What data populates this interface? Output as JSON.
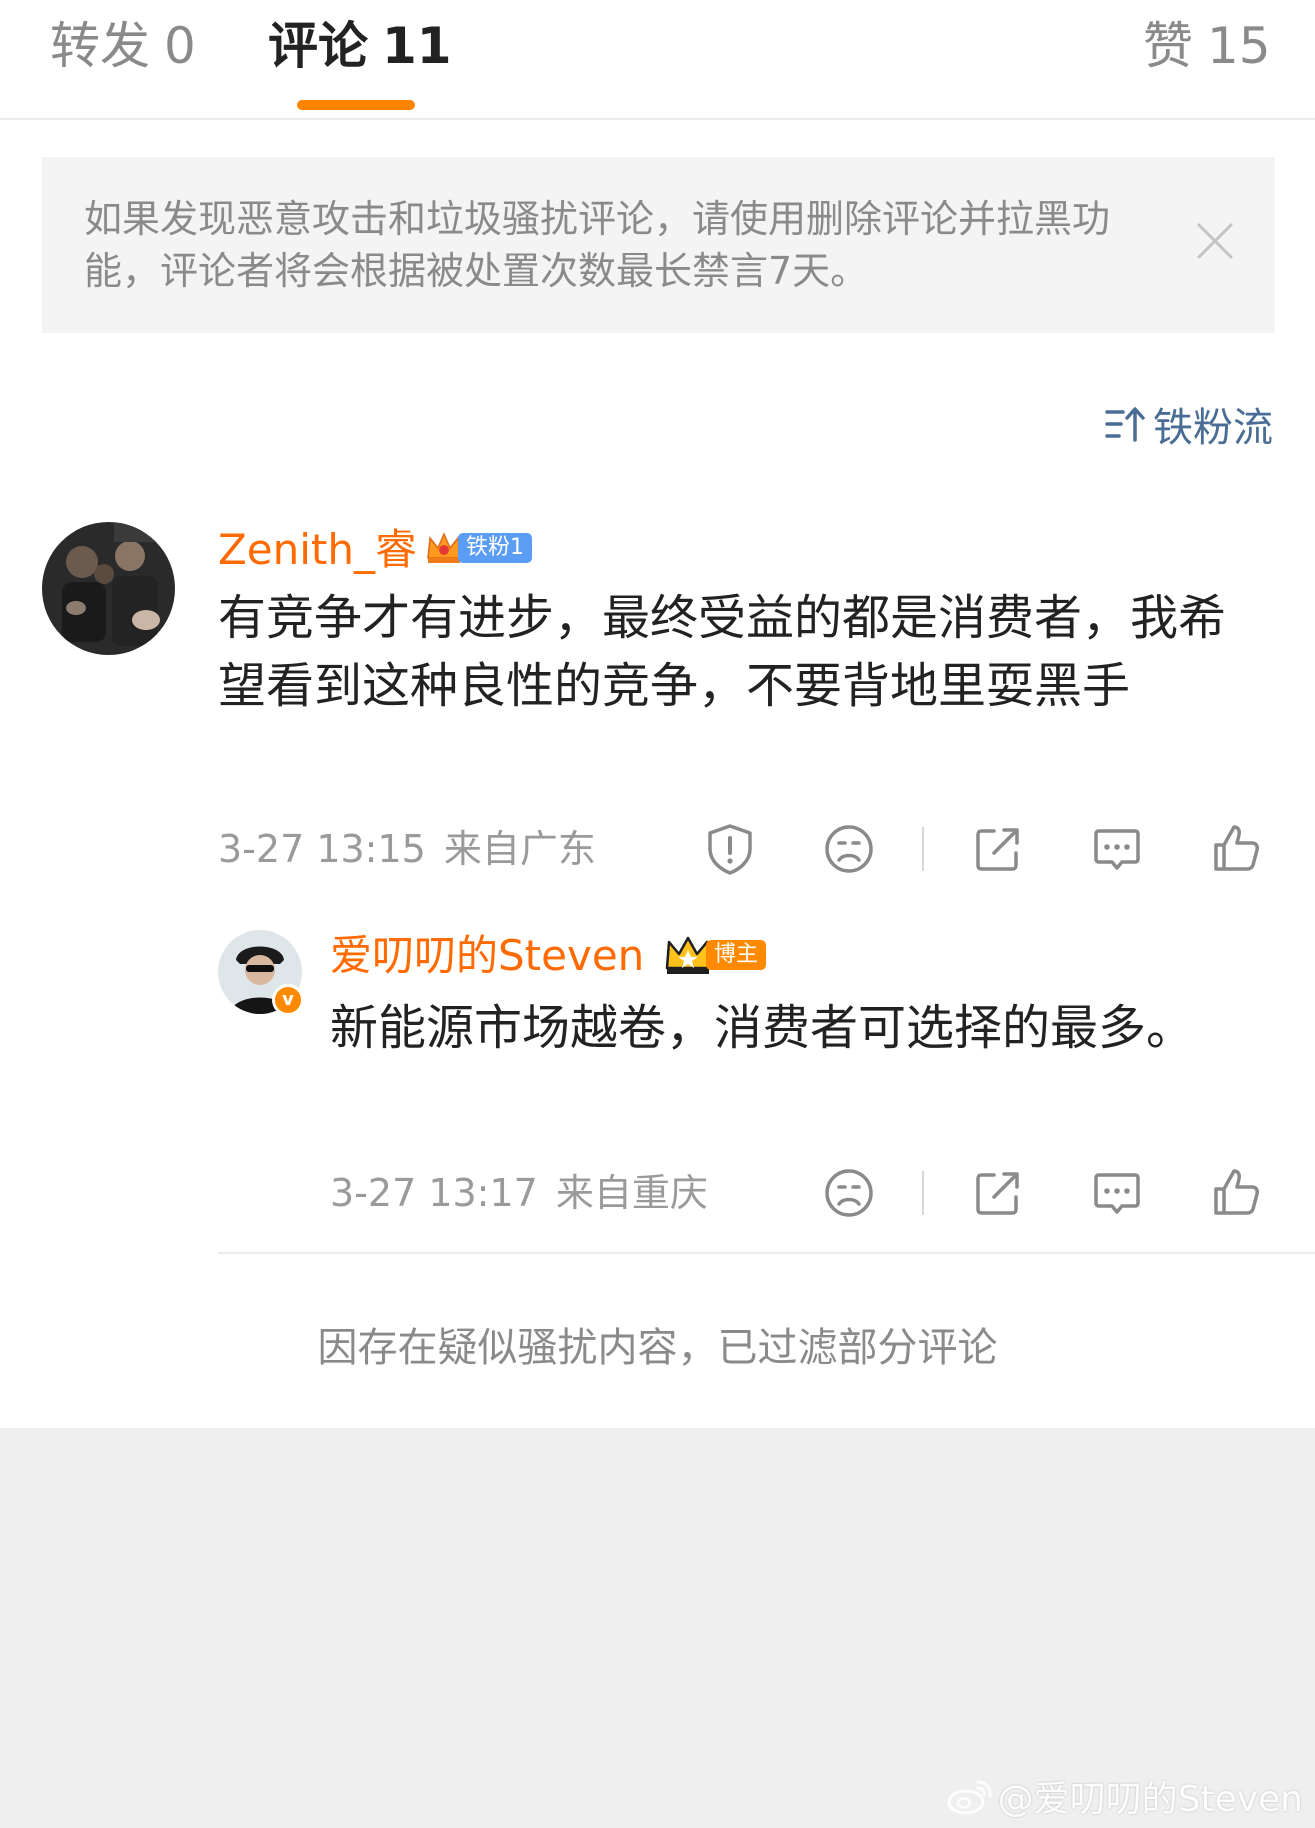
{
  "tabs": {
    "repost_label": "转发",
    "repost_count": "0",
    "comment_label": "评论",
    "comment_count": "11",
    "like_label": "赞",
    "like_count": "15"
  },
  "notice": {
    "text": "如果发现恶意攻击和垃圾骚扰评论，请使用删除评论并拉黑功能，评论者将会根据被处置次数最长禁言7天。"
  },
  "sort": {
    "label": "铁粉流",
    "icon": "sort-icon"
  },
  "comments": [
    {
      "username": "Zenith_睿",
      "badge": "铁粉1",
      "text": "有竞争才有进步，最终受益的都是消费者，我希望看到这种良性的竞争，不要背地里耍黑手",
      "time": "3-27 13:15",
      "location": "来自广东"
    }
  ],
  "reply": {
    "username": "爱叨叨的Steven",
    "badge": "博主",
    "text": "新能源市场越卷，消费者可选择的最多。",
    "time": "3-27 13:17",
    "location": "来自重庆"
  },
  "filter_note": "因存在疑似骚扰内容，已过滤部分评论",
  "watermark": "@爱叨叨的Steven",
  "colors": {
    "accent": "#ff8200",
    "username": "#ff6b00",
    "sort": "#4a6d96",
    "iron_fan_badge": "#5b9df5",
    "blogger_badge": "#ff8a00"
  }
}
